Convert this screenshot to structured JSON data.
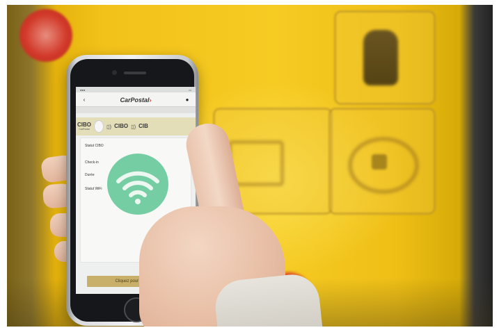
{
  "colors": {
    "bus_yellow": "#f2c21a",
    "wifi_green": "#66c99a",
    "cta_gold": "#c9b06a",
    "logo_red": "#e13a23"
  },
  "app": {
    "brand": "CarPostal",
    "header_left_icon": "back-arrow-icon",
    "header_right_icon": "user-icon",
    "subheader": "",
    "cibo_items": [
      {
        "title": "CIBO",
        "subtitle": "CarPostal"
      },
      {
        "title": "CIBO",
        "subtitle": ""
      },
      {
        "title": "CIB",
        "subtitle": ""
      }
    ],
    "rows": {
      "status": "Statut CIBO",
      "checkin": "Check-in",
      "duration": "Durée",
      "wifi": "Statut WiFi"
    },
    "wifi_icon": "wifi-icon",
    "cta_label": "Cliquez pour Check-in"
  }
}
